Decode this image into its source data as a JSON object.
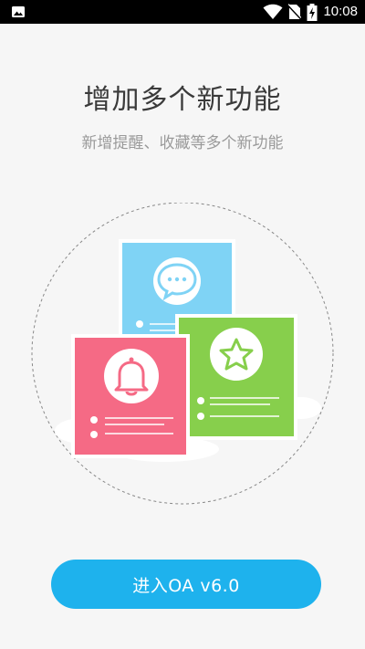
{
  "status_bar": {
    "time": "10:08",
    "icons": [
      "image-notification-icon",
      "wifi-icon",
      "no-sim-icon",
      "battery-charging-icon"
    ]
  },
  "title": "增加多个新功能",
  "subtitle": "新增提醒、收藏等多个新功能",
  "illustration": {
    "cards": [
      {
        "name": "message",
        "icon": "chat-bubble-icon",
        "color": "#7fd3f5"
      },
      {
        "name": "reminder",
        "icon": "bell-icon",
        "color": "#f56a85"
      },
      {
        "name": "favorite",
        "icon": "star-icon",
        "color": "#87cf4c"
      }
    ],
    "accent_colors": {
      "blue_card": "#7fd3f5",
      "pink_card": "#f56a85",
      "green_card": "#87cf4c"
    }
  },
  "enter_button": {
    "label": "进入OA v6.0",
    "color": "#1eb2ed"
  }
}
